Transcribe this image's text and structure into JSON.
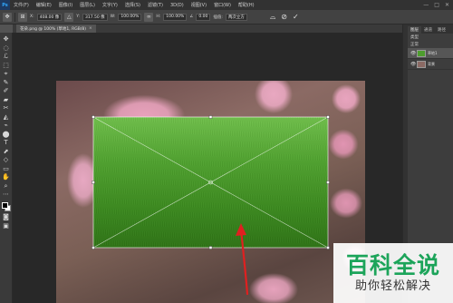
{
  "menubar": {
    "logo": "Ps",
    "items": [
      "文件(F)",
      "编辑(E)",
      "图像(I)",
      "图层(L)",
      "文字(Y)",
      "选择(S)",
      "滤镜(T)",
      "3D(D)",
      "视图(V)",
      "窗口(W)",
      "帮助(H)"
    ],
    "window_controls": [
      "—",
      "□",
      "✕"
    ]
  },
  "options": {
    "x_label": "X:",
    "x_value": "408.00 像",
    "y_label": "Y:",
    "y_value": "317.50 像",
    "w_label": "W:",
    "w_value": "100.00%",
    "h_label": "H:",
    "h_value": "100.00%",
    "angle_label": "∠",
    "angle_value": "0.00",
    "interp_label": "插值:",
    "interp_value": "两次立方",
    "cancel_glyph": "⊘",
    "commit_glyph": "✓"
  },
  "document": {
    "tab_label": "花朵.png @ 100% (草地1, RGB/8)",
    "close_glyph": "×"
  },
  "tools": [
    "✥",
    "◌",
    "ℒ",
    "⬚",
    "⌖",
    "✎",
    "✐",
    "▰",
    "✂",
    "◭",
    "⌁",
    "⬤",
    "T",
    "⬈",
    "◇",
    "▭",
    "✋",
    "⌕",
    "⋯"
  ],
  "layers_panel": {
    "tabs": [
      "图层",
      "通道",
      "路径"
    ],
    "filter_label": "类型",
    "blend_mode": "正常",
    "layers": [
      {
        "name": "草地1",
        "thumb_color": "#4e9d2e",
        "selected": true
      },
      {
        "name": "背景",
        "thumb_color": "#8b6a64",
        "selected": false
      }
    ]
  },
  "watermark": {
    "main": "百科全说",
    "sub": "助你轻松解决",
    "color": "#1ca45a"
  },
  "colors": {
    "accent_arrow": "#e02020",
    "transform_line": "#ffffff"
  }
}
